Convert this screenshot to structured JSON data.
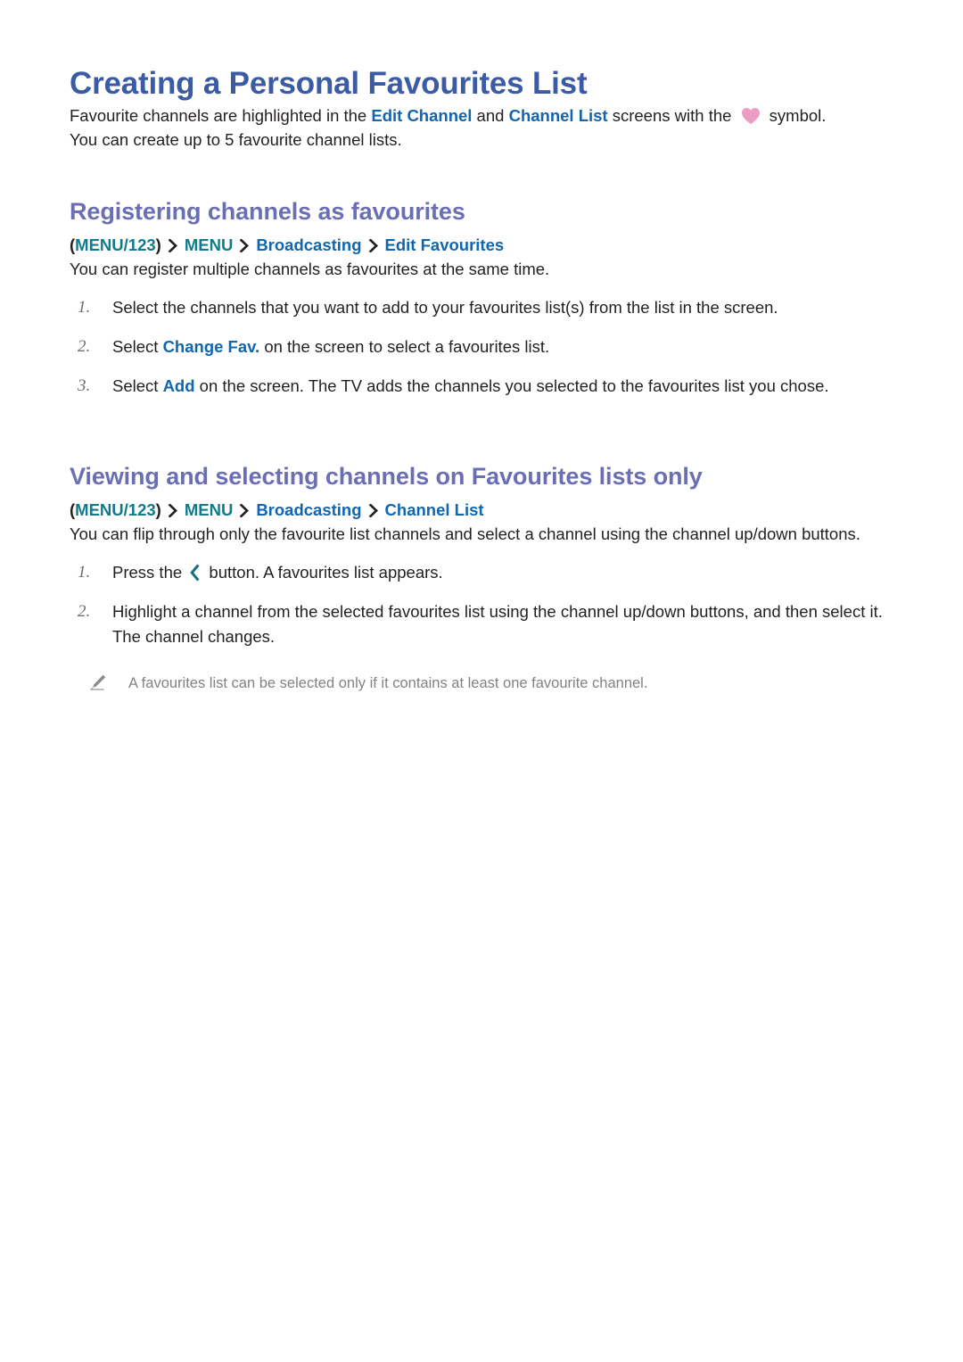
{
  "page": {
    "title": "Creating a Personal Favourites List",
    "intro": {
      "part1": "Favourite channels are highlighted in the ",
      "kw1": "Edit Channel",
      "part2": " and ",
      "kw2": "Channel List",
      "part3": " screens with the ",
      "heart_icon": "heart-icon",
      "part4": " symbol.",
      "line2": "You can create up to 5 favourite channel lists."
    }
  },
  "sections": [
    {
      "heading": "Registering channels as favourites",
      "breadcrumb": {
        "open_paren": "(",
        "item1": "MENU/123",
        "close_paren": ")",
        "item2": "MENU",
        "item3": "Broadcasting",
        "item4": "Edit Favourites"
      },
      "lead": "You can register multiple channels as favourites at the same time.",
      "steps": [
        {
          "num": "1.",
          "text_a": "Select the channels that you want to add to your favourites list(s) from the list in the screen.",
          "kw": "",
          "text_b": ""
        },
        {
          "num": "2.",
          "text_a": "Select ",
          "kw": "Change Fav.",
          "text_b": " on the screen to select a favourites list."
        },
        {
          "num": "3.",
          "text_a": "Select ",
          "kw": "Add",
          "text_b": " on the screen. The TV adds the channels you selected to the favourites list you chose."
        }
      ]
    },
    {
      "heading": "Viewing and selecting channels on Favourites lists only",
      "breadcrumb": {
        "open_paren": "(",
        "item1": "MENU/123",
        "close_paren": ")",
        "item2": "MENU",
        "item3": "Broadcasting",
        "item4": "Channel List"
      },
      "lead": "You can flip through only the favourite list channels and select a channel using the channel up/down buttons.",
      "steps": [
        {
          "num": "1.",
          "text_a": "Press the ",
          "icon": "chevron-left-icon",
          "text_b": " button. A favourites list appears."
        },
        {
          "num": "2.",
          "text_a": "Highlight a channel from the selected favourites list using the channel up/down buttons, and then select it. The channel changes.",
          "text_b": ""
        }
      ],
      "note": {
        "icon": "pencil-icon",
        "text": "A favourites list can be selected only if it contains at least one favourite channel."
      }
    }
  ],
  "colors": {
    "page_title": "#3b5ba5",
    "section_title": "#6a6fb5",
    "keyword_blue": "#1066b0",
    "keyword_teal": "#0e7c8c",
    "body": "#231f20",
    "note_gray": "#808285",
    "heart_pink": "#ed9cc3"
  }
}
